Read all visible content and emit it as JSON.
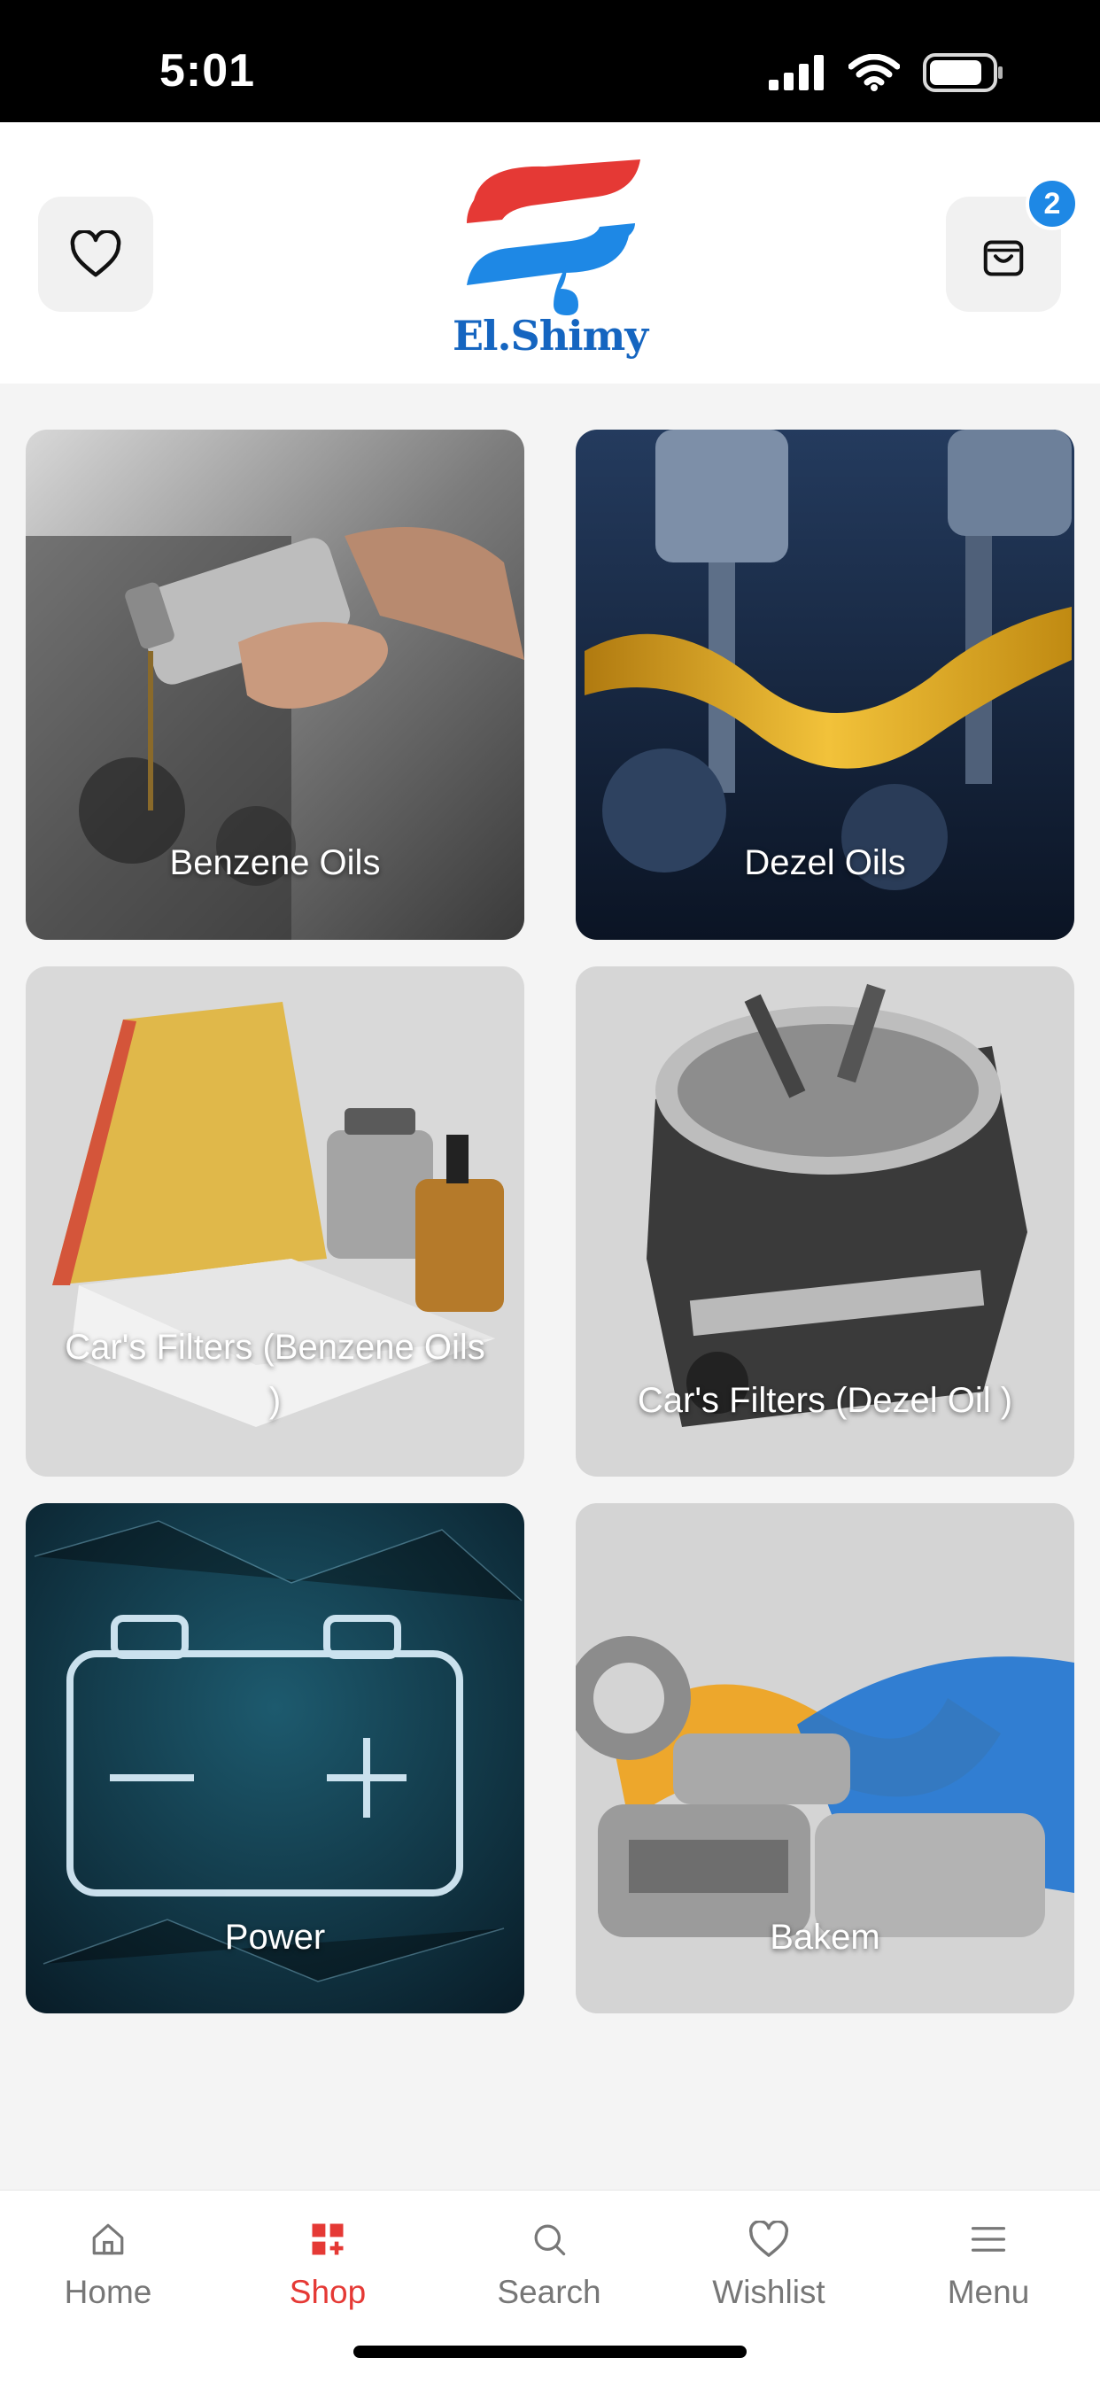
{
  "status_bar": {
    "time": "5:01"
  },
  "header": {
    "logo_text": "El.Shimy",
    "cart_count": "2",
    "colors": {
      "logo_red": "#e53935",
      "logo_blue": "#1e88e5",
      "badge": "#1e88e5"
    }
  },
  "categories": [
    {
      "label": "Benzene Oils",
      "image": "oil-pouring-engine-photo"
    },
    {
      "label": "Dezel Oils",
      "image": "engine-pistons-oil-splash-photo"
    },
    {
      "label": "Car's Filters (Benzene Oils )",
      "image": "air-and-oil-filters-photo"
    },
    {
      "label": "Car's Filters (Dezel Oil )",
      "image": "diesel-fuel-filter-photo"
    },
    {
      "label": "Power",
      "image": "glowing-battery-photo"
    },
    {
      "label": "Bakem",
      "image": "bearings-grease-photo"
    }
  ],
  "bottom_nav": {
    "active": "Shop",
    "active_color": "#e53935",
    "items": [
      {
        "label": "Home",
        "icon": "home-icon"
      },
      {
        "label": "Shop",
        "icon": "shop-grid-icon"
      },
      {
        "label": "Search",
        "icon": "search-icon"
      },
      {
        "label": "Wishlist",
        "icon": "heart-icon"
      },
      {
        "label": "Menu",
        "icon": "menu-icon"
      }
    ]
  }
}
